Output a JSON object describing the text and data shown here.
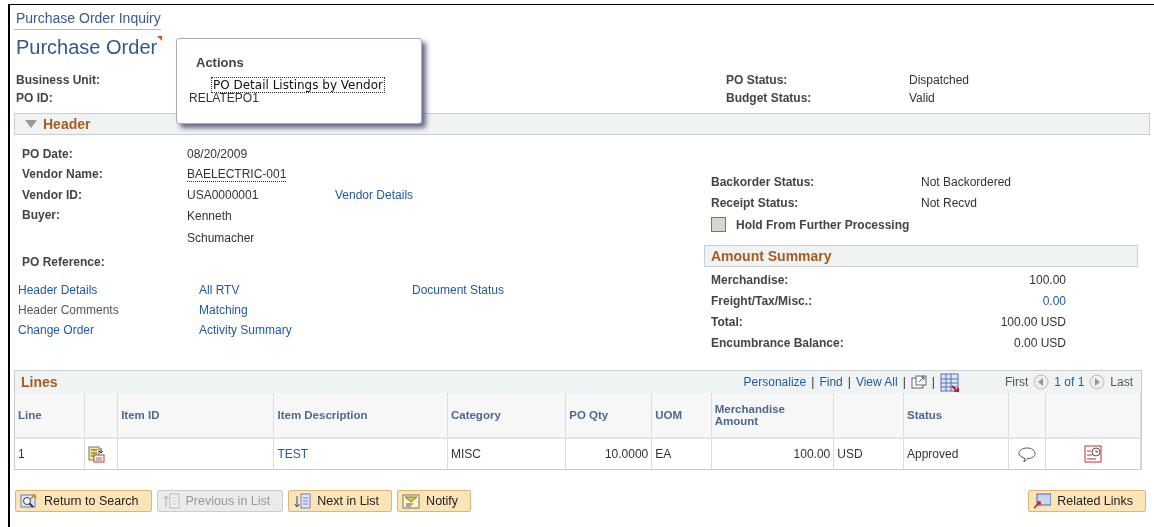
{
  "page_title": "Purchase Order Inquiry",
  "heading": "Purchase Order",
  "actions_menu": {
    "title": "Actions",
    "items": [
      {
        "label": "PO Detail Listings by Vendor",
        "focused": true
      }
    ]
  },
  "summary_left": [
    {
      "label": "Business Unit:"
    },
    {
      "label": "PO ID:",
      "value": "RELATEPO1"
    }
  ],
  "summary_right": [
    {
      "label": "PO Status:",
      "value": "Dispatched"
    },
    {
      "label": "Budget Status:",
      "value": "Valid"
    }
  ],
  "header_section": {
    "title": "Header",
    "expanded": true,
    "fields": [
      {
        "label": "PO Date:",
        "value": "08/20/2009",
        "kind": "text"
      },
      {
        "label": "Vendor Name:",
        "value": "BAELECTRIC-001",
        "kind": "hover"
      },
      {
        "label": "Vendor ID:",
        "value": "USA0000001",
        "kind": "text",
        "link": "Vendor Details"
      },
      {
        "label": "Buyer:",
        "value": "Kenneth Schumacher",
        "kind": "text"
      },
      {
        "label": "PO Reference:"
      }
    ],
    "status_fields": [
      {
        "label": "Backorder Status:",
        "value": "Not Backordered"
      },
      {
        "label": "Receipt Status:",
        "value": "Not Recvd"
      }
    ],
    "hold_checkbox": {
      "label": "Hold From Further Processing",
      "checked": false
    },
    "amount_summary": {
      "title": "Amount Summary",
      "rows": [
        {
          "label": "Merchandise:",
          "value": "100.00",
          "kind": "text"
        },
        {
          "label": "Freight/Tax/Misc.:",
          "value": "0.00",
          "kind": "link"
        },
        {
          "label": "Total:",
          "value": "100.00 USD",
          "kind": "text"
        },
        {
          "label": "Encumbrance Balance:",
          "value": "0.00 USD",
          "kind": "text"
        }
      ]
    },
    "link_columns": [
      [
        {
          "label": "Header Details",
          "disabled": false
        },
        {
          "label": "Header Comments",
          "disabled": true
        },
        {
          "label": "Change Order",
          "disabled": false
        }
      ],
      [
        {
          "label": "All RTV",
          "disabled": false
        },
        {
          "label": "Matching",
          "disabled": false
        },
        {
          "label": "Activity Summary",
          "disabled": false
        }
      ],
      [
        {
          "label": "Document Status",
          "disabled": false
        }
      ]
    ]
  },
  "lines": {
    "title": "Lines",
    "nav_items": [
      {
        "kind": "link",
        "label": "Personalize"
      },
      {
        "kind": "separator",
        "label": "|"
      },
      {
        "kind": "link",
        "label": "Find"
      },
      {
        "kind": "separator",
        "label": "|"
      },
      {
        "kind": "link",
        "label": "View All"
      },
      {
        "kind": "separator",
        "label": "|"
      },
      {
        "kind": "zoom"
      },
      {
        "kind": "separator",
        "label": "|"
      },
      {
        "kind": "download"
      }
    ],
    "first": "First",
    "range": "1 of 1",
    "last": "Last",
    "columns": [
      {
        "label": "Line"
      },
      {},
      {
        "label": "Item ID"
      },
      {
        "label": "Item Description"
      },
      {
        "label": "Category"
      },
      {
        "label": "PO Qty"
      },
      {
        "label": "UOM"
      },
      {
        "label": "Merchandise Amount"
      },
      {},
      {
        "label": "Status"
      },
      {},
      {}
    ],
    "rows": [
      {
        "line": "1",
        "description": "TEST",
        "category": "MISC",
        "po_qty": "10.0000",
        "uom": "EA",
        "amount": "100.00",
        "currency": "USD",
        "status": "Approved"
      }
    ]
  },
  "buttons": [
    {
      "label": "Return to Search",
      "disabled": false
    },
    {
      "label": "Previous in List",
      "disabled": true
    },
    {
      "label": "Next in List",
      "disabled": false
    },
    {
      "label": "Notify",
      "disabled": false
    }
  ],
  "related_links": "Related Links"
}
